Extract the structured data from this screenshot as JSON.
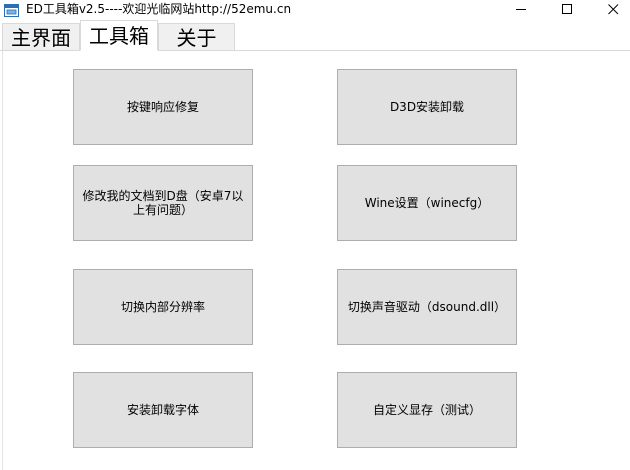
{
  "window": {
    "title": "ED工具箱v2.5----欢迎光临网站http://52emu.cn",
    "icon": "app-window-icon",
    "controls": {
      "minimize_icon": "minimize-icon",
      "maximize_icon": "maximize-icon",
      "close_icon": "close-icon"
    }
  },
  "tabs": [
    {
      "label": "主界面",
      "selected": false
    },
    {
      "label": "工具箱",
      "selected": true
    },
    {
      "label": "关于",
      "selected": false
    }
  ],
  "toolbox": {
    "buttons": [
      {
        "id": "key-response-fix",
        "label": "按键响应修复"
      },
      {
        "id": "d3d-install-uninstall",
        "label": "D3D安装卸载"
      },
      {
        "id": "move-documents-to-d",
        "label": "修改我的文档到D盘（安卓7以上有问题）"
      },
      {
        "id": "wine-settings",
        "label": "Wine设置（winecfg）"
      },
      {
        "id": "switch-internal-resolution",
        "label": "切换内部分辨率"
      },
      {
        "id": "switch-audio-driver",
        "label": "切换声音驱动（dsound.dll）"
      },
      {
        "id": "install-uninstall-fonts",
        "label": "安装卸载字体"
      },
      {
        "id": "custom-video-memory",
        "label": "自定义显存（测试）"
      }
    ]
  },
  "colors": {
    "button_face": "#e1e1e1",
    "button_border": "#adadad",
    "tab_inactive": "#f0f0f0",
    "tab_border": "#d9d9d9"
  }
}
